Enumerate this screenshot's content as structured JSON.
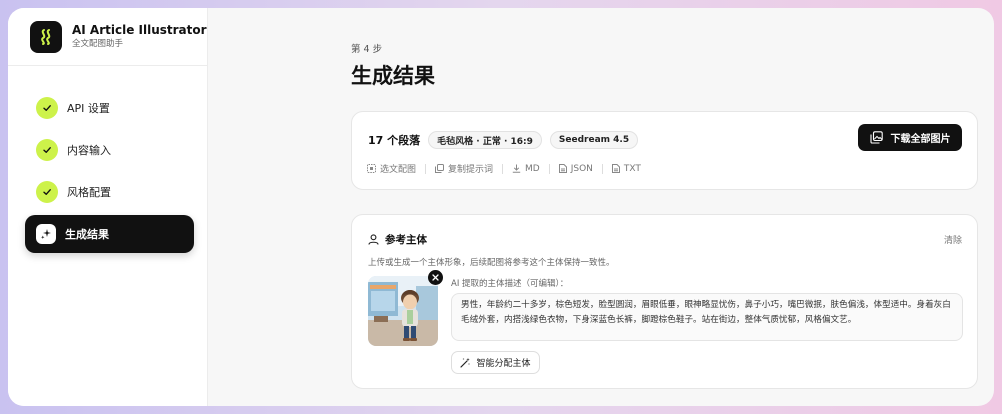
{
  "brand": {
    "title": "AI Article Illustrator",
    "subtitle": "全文配图助手"
  },
  "nav": [
    {
      "label": "API 设置",
      "done": true
    },
    {
      "label": "内容输入",
      "done": true
    },
    {
      "label": "风格配置",
      "done": true
    },
    {
      "label": "生成结果",
      "active": true
    }
  ],
  "step_label": "第 4 步",
  "page_title": "生成结果",
  "summary": {
    "segment_count": "17 个段落",
    "style_chip": "毛毡风格 · 正常 · 16:9",
    "model_chip": "Seedream 4.5",
    "download_label": "下载全部图片",
    "actions": {
      "select": "选文配图",
      "copy_prompt": "复制提示词",
      "md": "MD",
      "json": "JSON",
      "txt": "TXT"
    }
  },
  "reference": {
    "title": "参考主体",
    "clear_label": "清除",
    "description": "上传或生成一个主体形象，后续配图将参考这个主体保持一致性。",
    "ai_label": "AI 提取的主体描述（可编辑）：",
    "subject_text": "男性，年龄约二十多岁，棕色短发，脸型圆润，眉眼低垂，眼神略显忧伤，鼻子小巧，嘴巴微抿，肤色偏浅，体型适中。身着灰白毛绒外套，内搭浅绿色衣物，下身深蓝色长裤，脚蹬棕色鞋子。站在街边，整体气质忧郁，风格偏文艺。",
    "assign_label": "智能分配主体"
  },
  "colors": {
    "accent": "#cdf24a",
    "dark": "#111111"
  }
}
